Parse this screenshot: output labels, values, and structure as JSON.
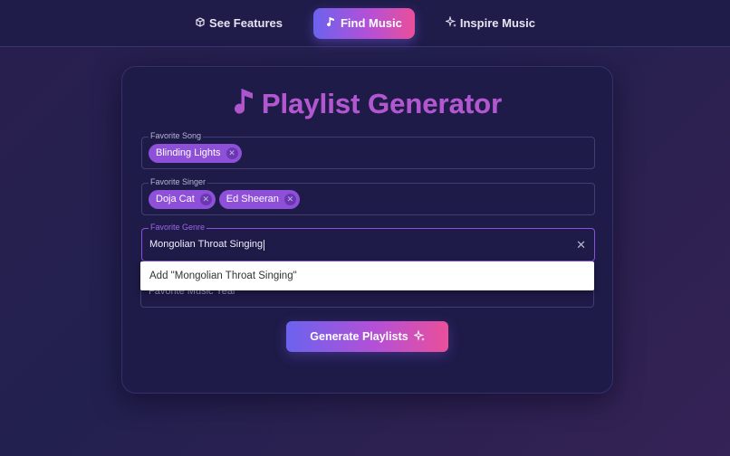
{
  "nav": {
    "items": [
      {
        "label": "See Features",
        "icon": "box-icon"
      },
      {
        "label": "Find Music",
        "icon": "music-note-icon",
        "active": true
      },
      {
        "label": "Inspire Music",
        "icon": "sparkle-icon"
      }
    ]
  },
  "page": {
    "title": "Playlist Generator",
    "title_icon": "music-note-icon"
  },
  "fields": {
    "song": {
      "label": "Favorite Song",
      "chips": [
        "Blinding Lights"
      ]
    },
    "singer": {
      "label": "Favorite Singer",
      "chips": [
        "Doja Cat",
        "Ed Sheeran"
      ]
    },
    "genre": {
      "label": "Favorite Genre",
      "value": "Mongolian Throat Singing"
    },
    "year": {
      "placeholder": "Favorite Music Year"
    }
  },
  "dropdown": {
    "option": "Add \"Mongolian Throat Singing\""
  },
  "actions": {
    "generate_label": "Generate Playlists"
  },
  "colors": {
    "accent_start": "#6b63ee",
    "accent_end": "#ea4f9a",
    "chip": "#8e4fd9"
  }
}
